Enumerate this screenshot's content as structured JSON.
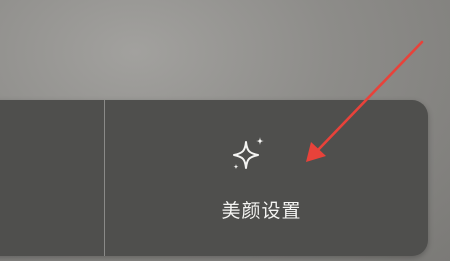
{
  "toolbar": {
    "beauty_settings": {
      "label": "美颜设置",
      "icon": "sparkle-icon"
    }
  },
  "annotation": {
    "arrow_color": "#e8423a"
  },
  "colors": {
    "panel": "#4f4f4d",
    "divider": "#8a8a88",
    "label_text": "#f4f4f2"
  }
}
